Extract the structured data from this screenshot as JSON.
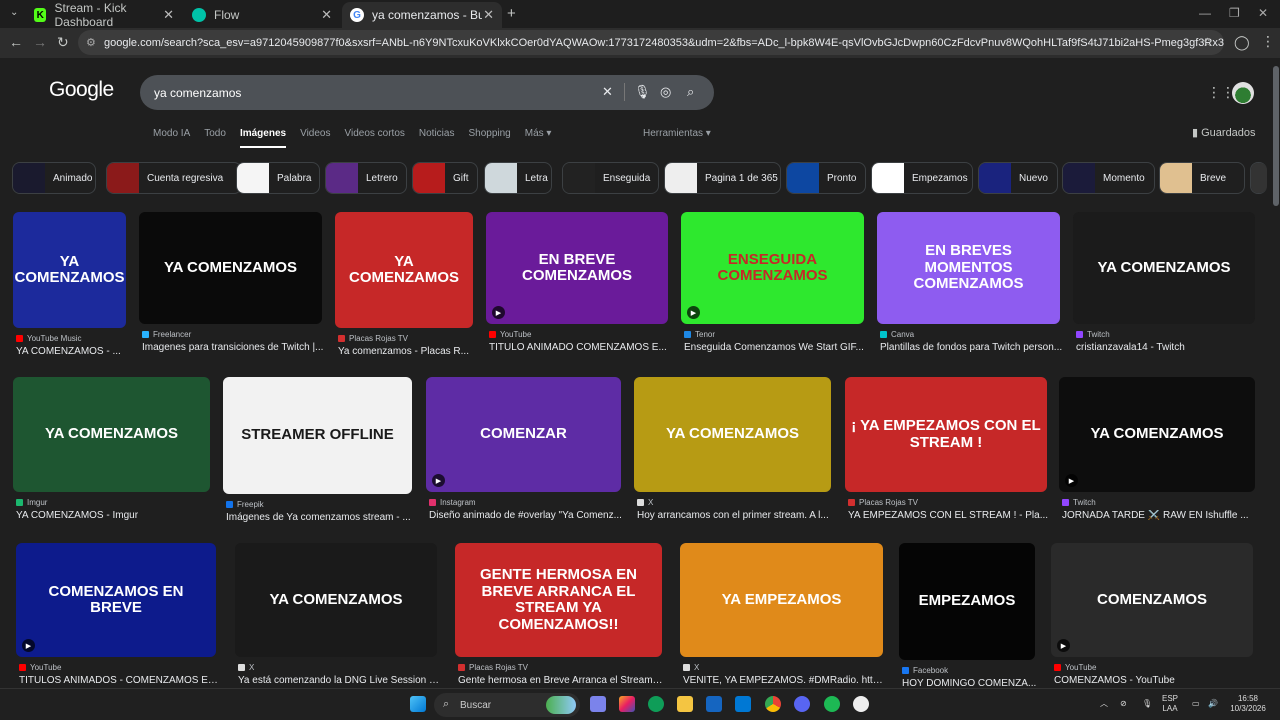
{
  "browser": {
    "tabs": [
      {
        "label": "Stream - Kick Dashboard",
        "icon": "kick-icon",
        "color": "#53fc18"
      },
      {
        "label": "Flow",
        "icon": "flow-icon",
        "color": "#00c2a8"
      },
      {
        "label": "ya comenzamos - Buscar con Go",
        "icon": "google-icon",
        "color": "#ffffff"
      }
    ],
    "url": "google.com/search?sca_esv=a9712045909877f0&sxsrf=ANbL-n6Y9NTcxuKoVKlxkCOer0dYAQWAOw:1773172480353&udm=2&fbs=ADc_l-bpk8W4E-qsVlOvbGJcDwpn60CzFdcvPnuv8WQohHLTaf9fS4tJ71bi2aHS-Pmeg3gf3Rx3g7wPLd9qB5u5EuZgnwrKvYM0fSATE..."
  },
  "google": {
    "logo": "Google",
    "query": "ya comenzamos",
    "nav": [
      "Modo IA",
      "Todo",
      "Imágenes",
      "Videos",
      "Videos cortos",
      "Noticias",
      "Shopping",
      "Más ▾"
    ],
    "tools": "Herramientas ▾",
    "saved": "Guardados"
  },
  "chips": [
    {
      "label": "Animado",
      "color": "#1a1a2e"
    },
    {
      "label": "Cuenta regresiva",
      "color": "#8b1a1a"
    },
    {
      "label": "Palabra",
      "color": "#f5f5f5"
    },
    {
      "label": "Letrero",
      "color": "#5b2a86"
    },
    {
      "label": "Gift",
      "color": "#b71c1c"
    },
    {
      "label": "Letra",
      "color": "#cfd8dc"
    },
    {
      "label": "Enseguida",
      "color": "#222"
    },
    {
      "label": "Pagina 1 de 365",
      "color": "#eeeeee"
    },
    {
      "label": "Pronto",
      "color": "#0d47a1"
    },
    {
      "label": "Empezamos",
      "color": "#ffffff"
    },
    {
      "label": "Nuevo",
      "color": "#1a237e"
    },
    {
      "label": "Momento",
      "color": "#1b1b3a"
    },
    {
      "label": "Breve",
      "color": "#e0c090"
    }
  ],
  "results": [
    {
      "source": "YouTube Music",
      "title": "YA COMENZAMOS - ...",
      "caption": "YA COMENZAMOS",
      "bg": "#1c2a9c",
      "fav": "#ff0000",
      "video": false
    },
    {
      "source": "Freelancer",
      "title": "Imagenes para transiciones de Twitch |...",
      "caption": "YA COMENZAMOS",
      "bg": "#0a0a0a",
      "fav": "#29b2fe",
      "video": false
    },
    {
      "source": "Placas Rojas TV",
      "title": "Ya comenzamos - Placas R...",
      "caption": "YA COMENZAMOS",
      "bg": "#c62828",
      "fav": "#d32f2f",
      "video": false
    },
    {
      "source": "YouTube",
      "title": "TITULO ANIMADO COMENZAMOS E...",
      "caption": "EN BREVE COMENZAMOS",
      "bg": "#6a1b9a",
      "fav": "#ff0000",
      "video": true
    },
    {
      "source": "Tenor",
      "title": "Enseguida Comenzamos We Start GIF...",
      "caption": "ENSEGUIDA COMENZAMOS",
      "bg": "#2ee82e",
      "fav": "#1e88e5",
      "video": true
    },
    {
      "source": "Canva",
      "title": "Plantillas de fondos para Twitch person...",
      "caption": "EN BREVES MOMENTOS COMENZAMOS",
      "bg": "#8e5cf0",
      "fav": "#00c4cc",
      "video": false
    },
    {
      "source": "Twitch",
      "title": "cristianzavala14 - Twitch",
      "caption": "YA COMENZAMOS",
      "bg": "#1b1b1b",
      "fav": "#9146ff",
      "video": false
    },
    {
      "source": "Imgur",
      "title": "YA COMENZAMOS - Imgur",
      "caption": "YA COMENZAMOS",
      "bg": "#1e5631",
      "fav": "#1bb76e",
      "video": false
    },
    {
      "source": "Freepik",
      "title": "Imágenes de Ya comenzamos stream - ...",
      "caption": "STREAMER OFFLINE",
      "bg": "#f2f2f2",
      "fav": "#1273eb",
      "video": false
    },
    {
      "source": "Instagram",
      "title": "Diseño animado de #overlay \"Ya Comenz...",
      "caption": "COMENZAR",
      "bg": "#5e2ca5",
      "fav": "#e1306c",
      "video": true
    },
    {
      "source": "X",
      "title": "Hoy arrancamos con el primer stream. A l...",
      "caption": "YA COMENZAMOS",
      "bg": "#b79b14",
      "fav": "#dddddd",
      "video": false
    },
    {
      "source": "Placas Rojas TV",
      "title": "YA EMPEZAMOS CON EL STREAM ! - Pla...",
      "caption": "¡ YA EMPEZAMOS CON EL STREAM !",
      "bg": "#c62828",
      "fav": "#d32f2f",
      "video": false
    },
    {
      "source": "Twitch",
      "title": "JORNADA TARDE ⚔️ RAW EN Ishuffle ...",
      "caption": "YA COMENZAMOS",
      "bg": "#0d0d0d",
      "fav": "#9146ff",
      "video": true
    },
    {
      "source": "YouTube",
      "title": "TITULOS ANIMADOS - COMENZAMOS EN ...",
      "caption": "COMENZAMOS EN BREVE",
      "bg": "#0d1b8c",
      "fav": "#ff0000",
      "video": true
    },
    {
      "source": "X",
      "title": "Ya está comenzando la DNG Live Session ft...",
      "caption": "YA COMENZAMOS",
      "bg": "#1a1a1a",
      "fav": "#dddddd",
      "video": false
    },
    {
      "source": "Placas Rojas TV",
      "title": "Gente hermosa en Breve Arranca el Stream y...",
      "caption": "GENTE HERMOSA EN BREVE ARRANCA EL STREAM YA COMENZAMOS!!",
      "bg": "#c62828",
      "fav": "#d32f2f",
      "video": false
    },
    {
      "source": "X",
      "title": "VENITE, YA EMPEZAMOS. #DMRadio. https...",
      "caption": "YA EMPEZAMOS",
      "bg": "#e08a1a",
      "fav": "#dddddd",
      "video": false
    },
    {
      "source": "Facebook",
      "title": "HOY DOMINGO COMENZA...",
      "caption": "EMPEZAMOS",
      "bg": "#050505",
      "fav": "#1877f2",
      "video": false
    },
    {
      "source": "YouTube",
      "title": "COMENZAMOS - YouTube",
      "caption": "COMENZAMOS",
      "bg": "#2a2a2a",
      "fav": "#ff0000",
      "video": true
    }
  ],
  "taskbar": {
    "search": "Buscar",
    "lang_top": "ESP",
    "lang_bottom": "LAA",
    "time": "16:58",
    "date": "10/3/2026"
  }
}
